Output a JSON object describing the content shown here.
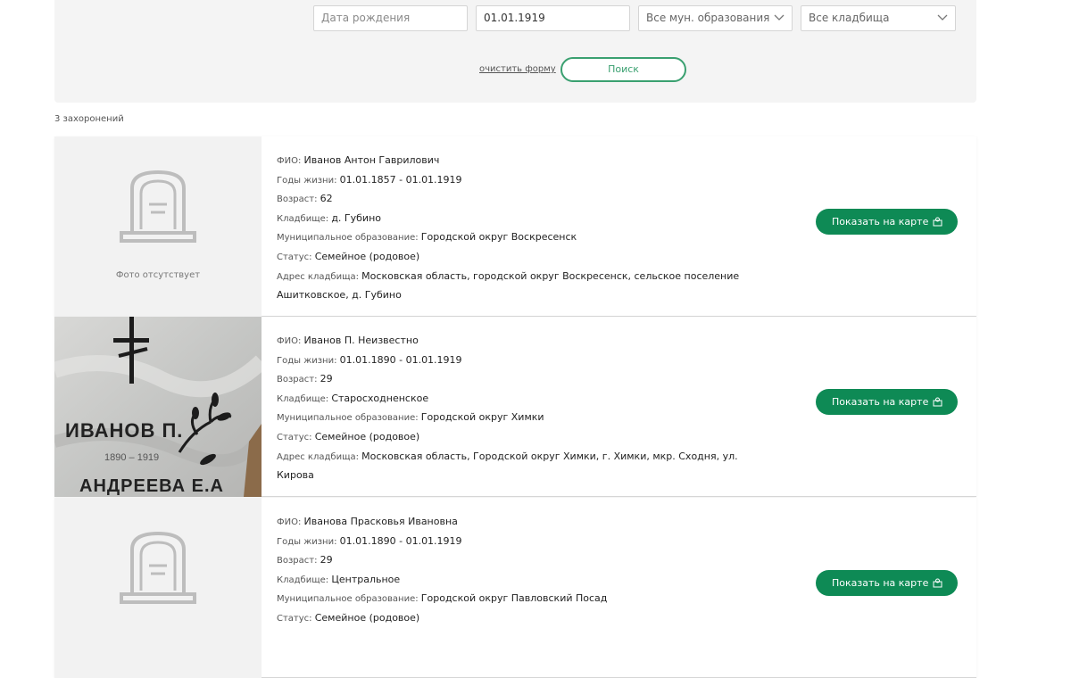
{
  "search": {
    "birth_date_placeholder": "Дата рождения",
    "death_date_value": "01.01.1919",
    "municipality_select": "Все мун. образования",
    "cemetery_select": "Все кладбища",
    "clear_label": "очистить форму",
    "search_label": "Поиск"
  },
  "results_count": "3 захоронений",
  "labels": {
    "fio": "ФИО: ",
    "years": "Годы жизни: ",
    "age": "Возраст: ",
    "cemetery": "Кладбище: ",
    "municipality": "Муниципальное образование: ",
    "status": "Статус: ",
    "address": "Адрес кладбища: ",
    "no_photo": "Фото отсутствует",
    "show_on_map": "Показать на карте"
  },
  "photo_text": {
    "name": "ИВАНОВ П.",
    "dates": "1890 – 1919",
    "other_name": "АНДРЕЕВА Е.А"
  },
  "colors": {
    "accent": "#0e8a55",
    "panel_bg": "#f4f4f4"
  },
  "results": [
    {
      "fio": "Иванов Антон Гаврилович",
      "years": "01.01.1857 - 01.01.1919",
      "age": "62",
      "cemetery": "д. Губино",
      "municipality": "Городской округ Воскресенск",
      "status": "Семейное (родовое)",
      "address": "Московская область, городской округ Воскресенск, сельское поселение Ашитковское, д. Губино",
      "has_photo": false
    },
    {
      "fio": "Иванов П. Неизвестно",
      "years": "01.01.1890 - 01.01.1919",
      "age": "29",
      "cemetery": "Старосходненское",
      "municipality": "Городской округ Химки",
      "status": "Семейное (родовое)",
      "address": "Московская область, Городской округ Химки, г. Химки, мкр. Сходня, ул. Кирова",
      "has_photo": true
    },
    {
      "fio": "Иванова Прасковья Ивановна",
      "years": "01.01.1890 - 01.01.1919",
      "age": "29",
      "cemetery": "Центральное",
      "municipality": "Городской округ Павловский Посад",
      "status": "Семейное (родовое)",
      "has_photo": false
    }
  ]
}
